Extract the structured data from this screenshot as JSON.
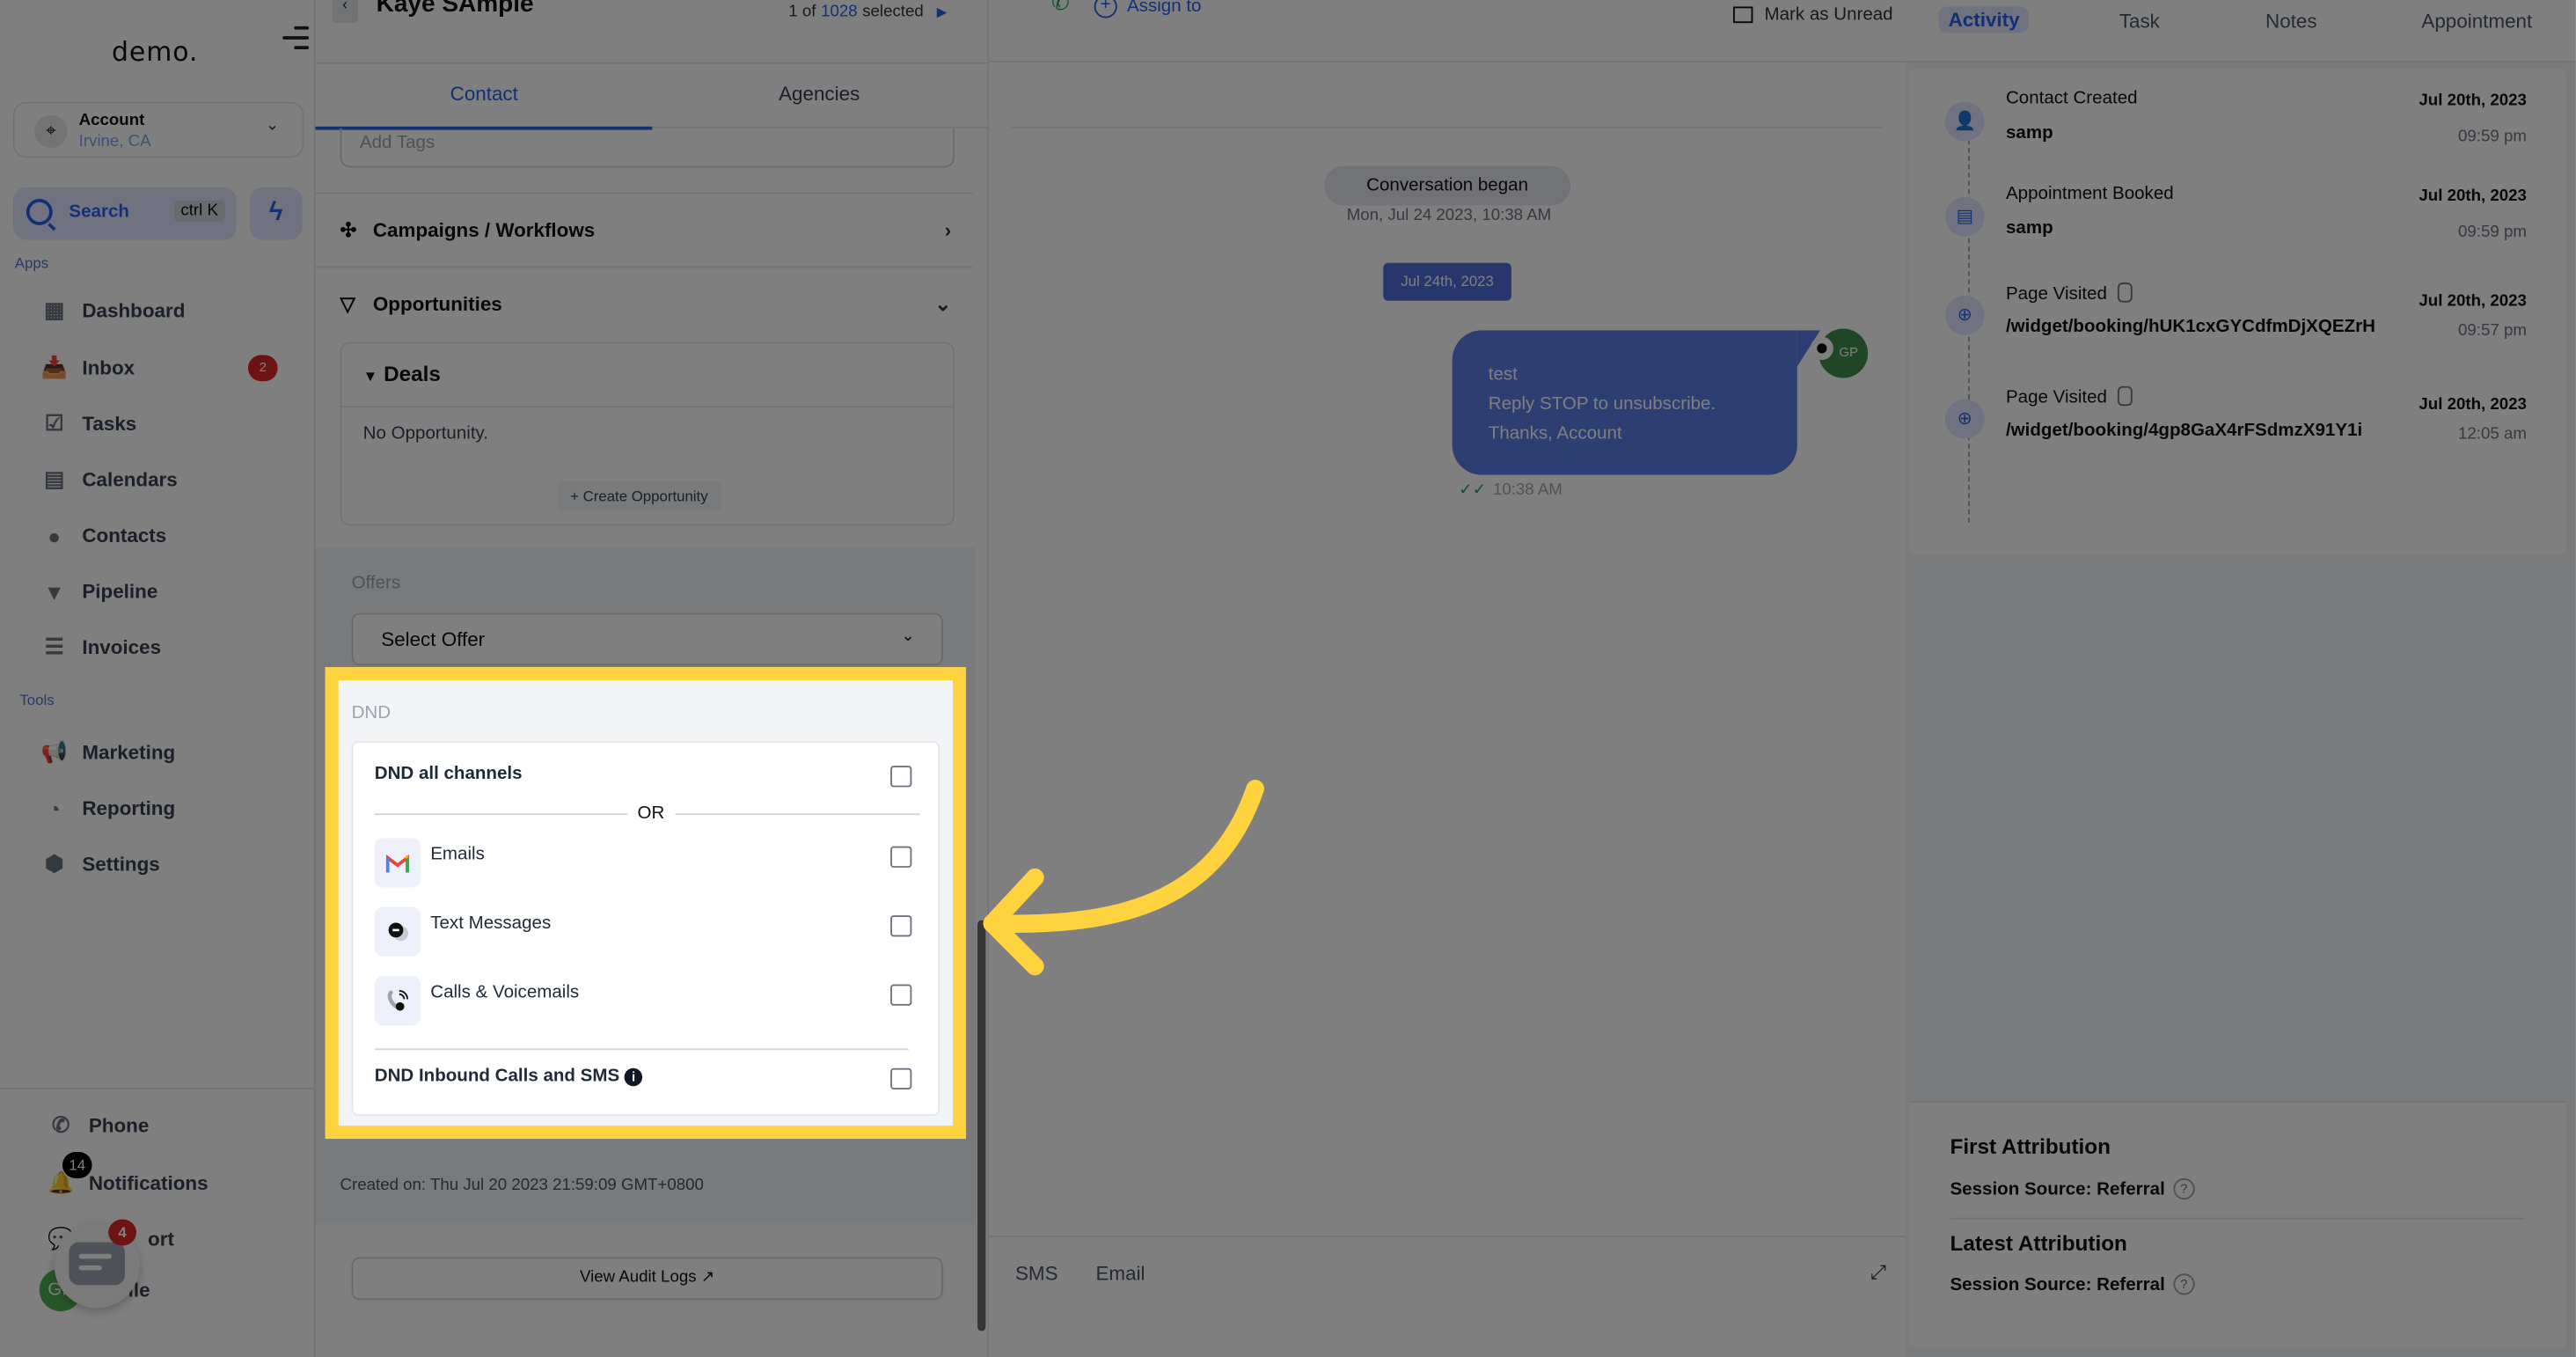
{
  "sidebar": {
    "logo": "demo.",
    "account": {
      "name": "Account",
      "location": "Irvine, CA"
    },
    "search": {
      "label": "Search",
      "shortcut": "ctrl K"
    },
    "apps_label": "Apps",
    "apps": [
      {
        "label": "Dashboard",
        "icon": "dashboard-icon"
      },
      {
        "label": "Inbox",
        "icon": "inbox-icon",
        "badge": "2"
      },
      {
        "label": "Tasks",
        "icon": "tasks-icon"
      },
      {
        "label": "Calendars",
        "icon": "calendar-icon"
      },
      {
        "label": "Contacts",
        "icon": "contacts-icon"
      },
      {
        "label": "Pipeline",
        "icon": "pipeline-icon"
      },
      {
        "label": "Invoices",
        "icon": "invoices-icon"
      }
    ],
    "tools_label": "Tools",
    "tools": [
      {
        "label": "Marketing",
        "icon": "megaphone-icon"
      },
      {
        "label": "Reporting",
        "icon": "reporting-icon"
      },
      {
        "label": "Settings",
        "icon": "settings-icon"
      }
    ],
    "bottom": {
      "phone": "Phone",
      "notifications": "Notifications",
      "notifications_badge": "14",
      "support": "Support",
      "support_visible": "ort",
      "profile": "Profile",
      "profile_visible": "file",
      "profile_initials": "GP",
      "chat_badge": "4"
    }
  },
  "contact": {
    "name": "Kaye SAmple",
    "pager": {
      "prefix": "1 of",
      "total": "1028",
      "suffix": "selected"
    },
    "tabs": [
      {
        "label": "Contact",
        "active": true
      },
      {
        "label": "Agencies",
        "active": false
      }
    ],
    "tags_placeholder": "Add Tags",
    "campaigns_label": "Campaigns / Workflows",
    "opportunities_label": "Opportunities",
    "deals": {
      "title": "Deals",
      "empty": "No Opportunity.",
      "create_label": "Create Opportunity"
    },
    "offers": {
      "label": "Offers",
      "select_placeholder": "Select Offer"
    },
    "dnd": {
      "label": "DND",
      "all_channels": {
        "label": "DND all channels",
        "checked": false
      },
      "or_label": "OR",
      "channels": [
        {
          "label": "Emails",
          "icon": "gmail-icon",
          "checked": false
        },
        {
          "label": "Text Messages",
          "icon": "text-message-icon",
          "checked": false
        },
        {
          "label": "Calls & Voicemails",
          "icon": "calls-voicemail-icon",
          "checked": false
        }
      ],
      "inbound": {
        "label": "DND Inbound Calls and SMS",
        "checked": false
      }
    },
    "created_on": "Created on: Thu Jul 20 2023 21:59:09 GMT+0800",
    "audit_label": "View Audit Logs"
  },
  "conversation": {
    "assign_label": "Assign to",
    "mark_unread_label": "Mark as Unread",
    "began_label": "Conversation began",
    "began_date": "Mon, Jul 24 2023, 10:38 AM",
    "date_chip": "Jul 24th, 2023",
    "message": {
      "lines": [
        "test",
        "Reply STOP to unsubscribe.",
        "Thanks, Account"
      ],
      "avatar": "GP",
      "time": "10:38 AM"
    },
    "compose_tabs": [
      "SMS",
      "Email"
    ]
  },
  "activity": {
    "tabs": [
      {
        "label": "Activity",
        "active": true
      },
      {
        "label": "Task",
        "active": false
      },
      {
        "label": "Notes",
        "active": false
      },
      {
        "label": "Appointment",
        "active": false
      }
    ],
    "items": [
      {
        "title": "Contact Created",
        "sub": "samp",
        "date": "Jul 20th, 2023",
        "time": "09:59 pm",
        "icon": "add-user-icon"
      },
      {
        "title": "Appointment Booked",
        "sub": "samp",
        "date": "Jul 20th, 2023",
        "time": "09:59 pm",
        "icon": "calendar-icon"
      },
      {
        "title": "Page Visited",
        "sub": "/widget/booking/hUK1cxGYCdfmDjXQEZrH",
        "date": "Jul 20th, 2023",
        "time": "09:57 pm",
        "icon": "globe-icon"
      },
      {
        "title": "Page Visited",
        "sub": "/widget/booking/4gp8GaX4rFSdmzX91Y1i",
        "date": "Jul 20th, 2023",
        "time": "12:05 am",
        "icon": "globe-icon"
      }
    ],
    "attribution": {
      "first_title": "First Attribution",
      "first_source": "Session Source: Referral",
      "latest_title": "Latest Attribution",
      "latest_source": "Session Source: Referral"
    }
  },
  "colors": {
    "accent": "#2563eb",
    "highlight": "#ffd23f",
    "message_bubble": "#5b7ee5",
    "badge_red": "#dc2626"
  }
}
